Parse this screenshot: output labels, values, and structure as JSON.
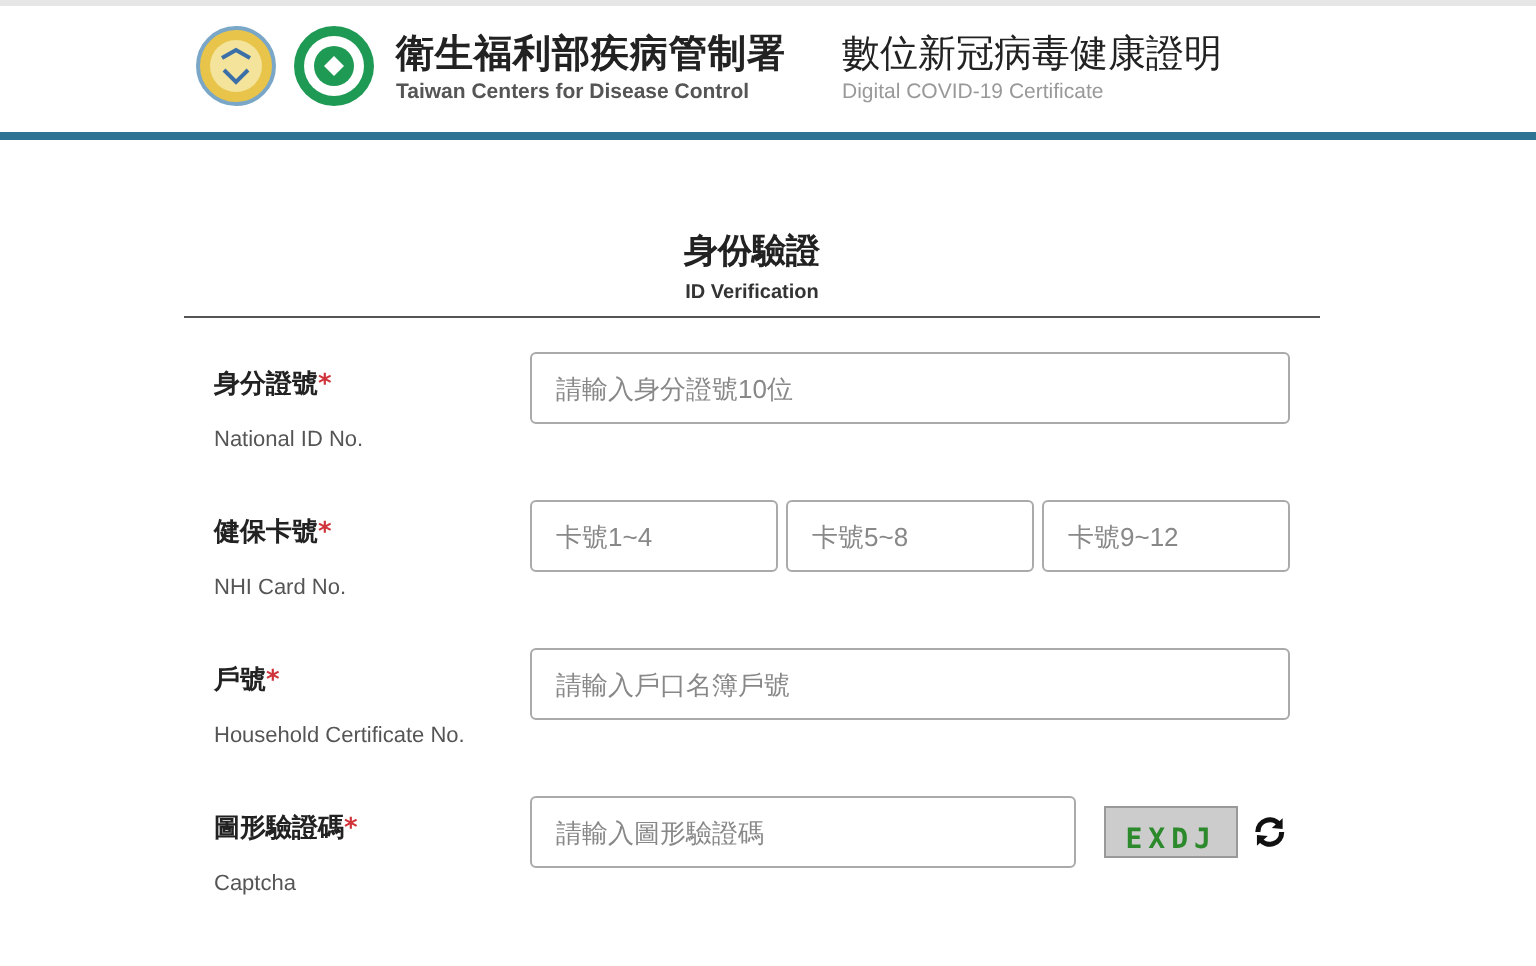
{
  "header": {
    "org_name": "衛生福利部疾病管制署",
    "org_name_en": "Taiwan Centers for Disease Control",
    "title": "數位新冠病毒健康證明",
    "title_en": "Digital COVID-19 Certificate"
  },
  "section": {
    "title": "身份驗證",
    "subtitle": "ID Verification"
  },
  "fields": [
    {
      "kind": "single",
      "label": "身分證號",
      "required_mark": "*",
      "label_en": "National ID No.",
      "inputs": [
        {
          "placeholder": "請輸入身分證號10位"
        }
      ]
    },
    {
      "kind": "triple",
      "label": "健保卡號",
      "required_mark": "*",
      "label_en": "NHI Card No.",
      "inputs": [
        {
          "placeholder": "卡號1~4"
        },
        {
          "placeholder": "卡號5~8"
        },
        {
          "placeholder": "卡號9~12"
        }
      ]
    },
    {
      "kind": "single",
      "label": "戶號",
      "required_mark": "*",
      "label_en": "Household Certificate No.",
      "inputs": [
        {
          "placeholder": "請輸入戶口名簿戶號"
        }
      ]
    },
    {
      "kind": "captcha",
      "label": "圖形驗證碼",
      "required_mark": "*",
      "label_en": "Captcha",
      "inputs": [
        {
          "placeholder": "請輸入圖形驗證碼"
        }
      ],
      "captcha_text": "EXDJ"
    }
  ]
}
